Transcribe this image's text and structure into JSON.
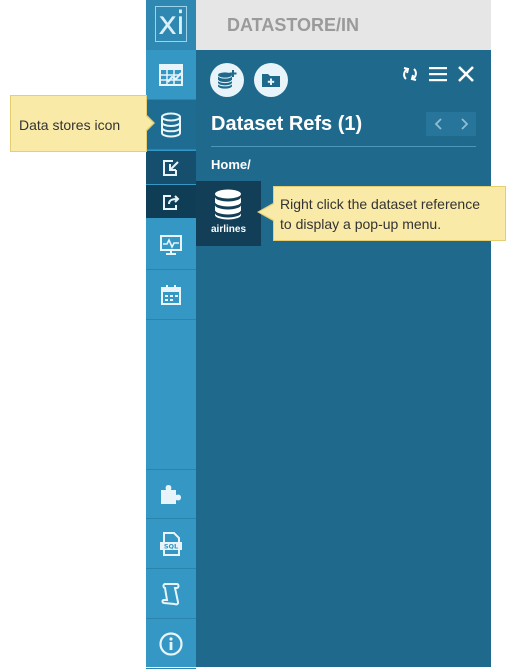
{
  "logo": {
    "text": "xi",
    "icon": "xi-logo"
  },
  "titlebar": {
    "title": "DATASTORE/IN"
  },
  "sidebar": {
    "items": [
      {
        "name": "dashboard",
        "icon": "spreadsheet-grid-icon"
      },
      {
        "name": "data-stores",
        "icon": "database-icon",
        "active": true
      },
      {
        "name": "import",
        "icon": "import-box-icon",
        "sub": true
      },
      {
        "name": "export",
        "icon": "export-box-icon",
        "sub": true
      },
      {
        "name": "monitor",
        "icon": "monitor-pulse-icon"
      },
      {
        "name": "calendar",
        "icon": "calendar-icon"
      },
      {
        "name": "plugins",
        "icon": "puzzle-piece-icon"
      },
      {
        "name": "sql",
        "icon": "sql-document-icon"
      },
      {
        "name": "scroll",
        "icon": "scroll-icon"
      },
      {
        "name": "info",
        "icon": "info-icon"
      }
    ]
  },
  "panel": {
    "title": "Dataset Refs (1)",
    "breadcrumb": "Home/",
    "actions": [
      {
        "name": "add-dataset",
        "icon": "database-plus-icon"
      },
      {
        "name": "add-folder",
        "icon": "folder-plus-icon"
      }
    ],
    "tools": [
      {
        "name": "refresh",
        "icon": "refresh-icon"
      },
      {
        "name": "menu",
        "icon": "hamburger-menu-icon"
      },
      {
        "name": "close",
        "icon": "close-icon"
      }
    ],
    "pager": {
      "prev_icon": "chevron-left-icon",
      "next_icon": "chevron-right-icon"
    },
    "items": [
      {
        "label": "airlines",
        "icon": "database-icon"
      }
    ]
  },
  "callouts": {
    "data_stores": "Data stores icon",
    "right_click_line1": "Right click the dataset reference",
    "right_click_line2": "to display a pop-up menu."
  },
  "colors": {
    "sidebar": "#3497c4",
    "panel": "#1f6a8c",
    "active": "#1e6c92",
    "callout": "#faeaa8"
  }
}
